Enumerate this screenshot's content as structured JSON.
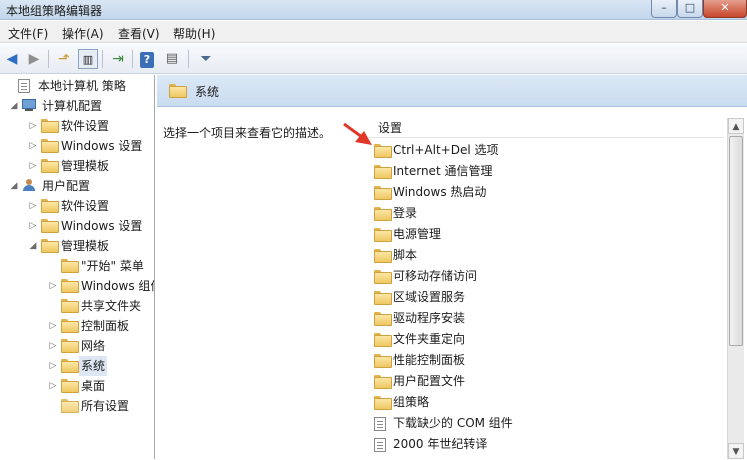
{
  "window": {
    "title": "本地组策略编辑器"
  },
  "menu": [
    "文件(F)",
    "操作(A)",
    "查看(V)",
    "帮助(H)"
  ],
  "tree": [
    {
      "label": "本地计算机 策略",
      "level": 0,
      "arrow": "",
      "icon": "policy"
    },
    {
      "label": "计算机配置",
      "level": 1,
      "arrow": "◢",
      "icon": "computer"
    },
    {
      "label": "软件设置",
      "level": 2,
      "arrow": "▷",
      "icon": "folder"
    },
    {
      "label": "Windows 设置",
      "level": 2,
      "arrow": "▷",
      "icon": "folder"
    },
    {
      "label": "管理模板",
      "level": 2,
      "arrow": "▷",
      "icon": "folder"
    },
    {
      "label": "用户配置",
      "level": 1,
      "arrow": "◢",
      "icon": "user"
    },
    {
      "label": "软件设置",
      "level": 2,
      "arrow": "▷",
      "icon": "folder"
    },
    {
      "label": "Windows 设置",
      "level": 2,
      "arrow": "▷",
      "icon": "folder"
    },
    {
      "label": "管理模板",
      "level": 2,
      "arrow": "◢",
      "icon": "folder"
    },
    {
      "label": "\"开始\" 菜单",
      "level": 3,
      "arrow": "",
      "icon": "folder"
    },
    {
      "label": "Windows 组件",
      "level": 3,
      "arrow": "▷",
      "icon": "folder"
    },
    {
      "label": "共享文件夹",
      "level": 3,
      "arrow": "",
      "icon": "folder"
    },
    {
      "label": "控制面板",
      "level": 3,
      "arrow": "▷",
      "icon": "folder"
    },
    {
      "label": "网络",
      "level": 3,
      "arrow": "▷",
      "icon": "folder"
    },
    {
      "label": "系统",
      "level": 3,
      "arrow": "▷",
      "icon": "folder",
      "selected": true
    },
    {
      "label": "桌面",
      "level": 3,
      "arrow": "▷",
      "icon": "folder"
    },
    {
      "label": "所有设置",
      "level": 3,
      "arrow": "",
      "icon": "allsettings"
    }
  ],
  "panel": {
    "title": "系统",
    "description": "选择一个项目来查看它的描述。",
    "column_header": "设置",
    "items": [
      {
        "label": "Ctrl+Alt+Del 选项",
        "icon": "folder"
      },
      {
        "label": "Internet 通信管理",
        "icon": "folder"
      },
      {
        "label": "Windows 热启动",
        "icon": "folder"
      },
      {
        "label": "登录",
        "icon": "folder"
      },
      {
        "label": "电源管理",
        "icon": "folder"
      },
      {
        "label": "脚本",
        "icon": "folder"
      },
      {
        "label": "可移动存储访问",
        "icon": "folder"
      },
      {
        "label": "区域设置服务",
        "icon": "folder"
      },
      {
        "label": "驱动程序安装",
        "icon": "folder"
      },
      {
        "label": "文件夹重定向",
        "icon": "folder"
      },
      {
        "label": "性能控制面板",
        "icon": "folder"
      },
      {
        "label": "用户配置文件",
        "icon": "folder"
      },
      {
        "label": "组策略",
        "icon": "folder"
      },
      {
        "label": "下载缺少的 COM 组件",
        "icon": "setting"
      },
      {
        "label": "2000 年世纪转译",
        "icon": "setting"
      }
    ]
  },
  "colors": {
    "accent_arrow": "#e0392a",
    "header_bg": "#cfe0f2",
    "selection": "#dde7f4"
  }
}
